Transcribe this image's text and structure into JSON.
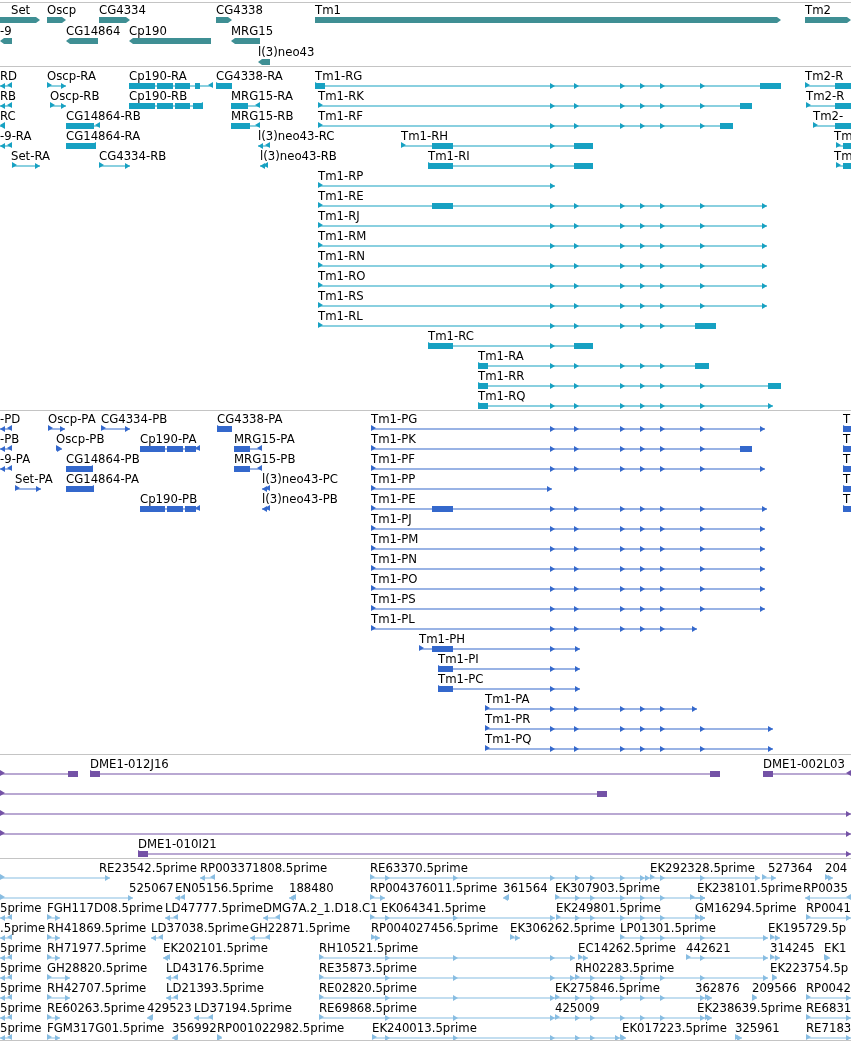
{
  "tracks": [
    {
      "kind": "gene",
      "features": [
        {
          "label": "Set",
          "reverse": false
        },
        {
          "label": "Oscp",
          "reverse": false
        },
        {
          "label": "CG4334",
          "reverse": false
        },
        {
          "label": "CG4338",
          "reverse": false
        },
        {
          "label": "Tm1",
          "reverse": false
        },
        {
          "label": "Tm2",
          "reverse": false
        },
        {
          "label": "-9",
          "reverse": true
        },
        {
          "label": "CG14864",
          "reverse": true
        },
        {
          "label": "Cp190",
          "reverse": true
        },
        {
          "label": "MRG15",
          "reverse": true
        },
        {
          "label": "l(3)neo43",
          "reverse": true
        }
      ]
    },
    {
      "kind": "transcript",
      "features": [
        {
          "label": "RD",
          "reverse": true
        },
        {
          "label": "Oscp-RA",
          "reverse": false
        },
        {
          "label": "Cp190-RA",
          "reverse": true
        },
        {
          "label": "CG4338-RA",
          "reverse": false
        },
        {
          "label": "Tm1-RG",
          "reverse": false
        },
        {
          "label": "Tm2-R",
          "reverse": false
        },
        {
          "label": "RB",
          "reverse": true
        },
        {
          "label": "Oscp-RB",
          "reverse": false
        },
        {
          "label": "Cp190-RB",
          "reverse": true
        },
        {
          "label": "MRG15-RA",
          "reverse": true
        },
        {
          "label": "Tm1-RK",
          "reverse": false
        },
        {
          "label": "Tm2-R",
          "reverse": false
        },
        {
          "label": "RC",
          "reverse": true
        },
        {
          "label": "CG14864-RB",
          "reverse": true
        },
        {
          "label": "MRG15-RB",
          "reverse": true
        },
        {
          "label": "Tm1-RF",
          "reverse": false
        },
        {
          "label": "Tm2-",
          "reverse": false
        },
        {
          "label": "-9-RA",
          "reverse": true
        },
        {
          "label": "CG14864-RA",
          "reverse": true
        },
        {
          "label": "l(3)neo43-RC",
          "reverse": true
        },
        {
          "label": "Tm1-RH",
          "reverse": false
        },
        {
          "label": "Tm",
          "reverse": false
        },
        {
          "label": "Set-RA",
          "reverse": false
        },
        {
          "label": "CG4334-RB",
          "reverse": false
        },
        {
          "label": "l(3)neo43-RB",
          "reverse": true
        },
        {
          "label": "Tm1-RI",
          "reverse": false
        },
        {
          "label": "Tm",
          "reverse": false
        },
        {
          "label": "Tm1-RP",
          "reverse": false
        },
        {
          "label": "Tm1-RE",
          "reverse": false
        },
        {
          "label": "Tm1-RJ",
          "reverse": false
        },
        {
          "label": "Tm1-RM",
          "reverse": false
        },
        {
          "label": "Tm1-RN",
          "reverse": false
        },
        {
          "label": "Tm1-RO",
          "reverse": false
        },
        {
          "label": "Tm1-RS",
          "reverse": false
        },
        {
          "label": "Tm1-RL",
          "reverse": false
        },
        {
          "label": "Tm1-RC",
          "reverse": false
        },
        {
          "label": "Tm1-RA",
          "reverse": false
        },
        {
          "label": "Tm1-RR",
          "reverse": false
        },
        {
          "label": "Tm1-RQ",
          "reverse": false
        }
      ]
    },
    {
      "kind": "cds",
      "features": [
        {
          "label": "-PD",
          "reverse": true
        },
        {
          "label": "Oscp-PA",
          "reverse": false
        },
        {
          "label": "CG4334-PB",
          "reverse": false
        },
        {
          "label": "CG4338-PA",
          "reverse": false
        },
        {
          "label": "Tm1-PG",
          "reverse": false
        },
        {
          "label": "T",
          "reverse": false
        },
        {
          "label": "-PB",
          "reverse": true
        },
        {
          "label": "Oscp-PB",
          "reverse": false
        },
        {
          "label": "Cp190-PA",
          "reverse": true
        },
        {
          "label": "MRG15-PA",
          "reverse": true
        },
        {
          "label": "Tm1-PK",
          "reverse": false
        },
        {
          "label": "T",
          "reverse": false
        },
        {
          "label": "-9-PA",
          "reverse": true
        },
        {
          "label": "CG14864-PB",
          "reverse": true
        },
        {
          "label": "MRG15-PB",
          "reverse": true
        },
        {
          "label": "Tm1-PF",
          "reverse": false
        },
        {
          "label": "T",
          "reverse": false
        },
        {
          "label": "Set-PA",
          "reverse": false
        },
        {
          "label": "CG14864-PA",
          "reverse": true
        },
        {
          "label": "l(3)neo43-PC",
          "reverse": true
        },
        {
          "label": "Tm1-PP",
          "reverse": false
        },
        {
          "label": "T",
          "reverse": false
        },
        {
          "label": "Cp190-PB",
          "reverse": true
        },
        {
          "label": "l(3)neo43-PB",
          "reverse": true
        },
        {
          "label": "Tm1-PE",
          "reverse": false
        },
        {
          "label": "T",
          "reverse": false
        },
        {
          "label": "Tm1-PJ",
          "reverse": false
        },
        {
          "label": "Tm1-PM",
          "reverse": false
        },
        {
          "label": "Tm1-PN",
          "reverse": false
        },
        {
          "label": "Tm1-PO",
          "reverse": false
        },
        {
          "label": "Tm1-PS",
          "reverse": false
        },
        {
          "label": "Tm1-PL",
          "reverse": false
        },
        {
          "label": "Tm1-PH",
          "reverse": false
        },
        {
          "label": "Tm1-PI",
          "reverse": false
        },
        {
          "label": "Tm1-PC",
          "reverse": false
        },
        {
          "label": "Tm1-PA",
          "reverse": false
        },
        {
          "label": "Tm1-PR",
          "reverse": false
        },
        {
          "label": "Tm1-PQ",
          "reverse": false
        }
      ]
    },
    {
      "kind": "clone",
      "features": [
        {
          "reverse": false
        },
        {
          "label": "DME1-012J16",
          "reverse": false
        },
        {
          "label": "DME1-002L03",
          "reverse": true
        },
        {
          "reverse": false
        },
        {
          "reverse": false
        },
        {
          "reverse": false
        },
        {
          "label": "DME1-010I21",
          "reverse": false
        }
      ]
    },
    {
      "kind": "est",
      "features": [
        {
          "label": "RE23542.5prime",
          "reverse": false
        },
        {
          "label": "RP003371808.5prime",
          "reverse": true
        },
        {
          "label": "RE63370.5prime",
          "reverse": false
        },
        {
          "label": "EK292328.5prime",
          "reverse": false
        },
        {
          "label": "527364",
          "reverse": false
        },
        {
          "label": "204",
          "reverse": false
        },
        {
          "label": "525067",
          "reverse": false
        },
        {
          "label": "EN05156.5prime",
          "reverse": true
        },
        {
          "label": "188480",
          "reverse": true
        },
        {
          "label": "RP004376011.5prime",
          "reverse": false
        },
        {
          "label": "361564",
          "reverse": true
        },
        {
          "label": "EK307903.5prime",
          "reverse": false
        },
        {
          "label": "EK238101.5prime",
          "reverse": false
        },
        {
          "label": "RP0035",
          "reverse": true
        },
        {
          "label": "5prime",
          "reverse": true
        },
        {
          "label": "FGH117D08.5prime",
          "reverse": false
        },
        {
          "label": "LD47777.5prime",
          "reverse": true
        },
        {
          "label": "DMG7A.2_1.D18.C1",
          "reverse": true
        },
        {
          "label": "EK064341.5prime",
          "reverse": false
        },
        {
          "label": "EK249801.5prime",
          "reverse": false
        },
        {
          "label": "GM16294.5prime",
          "reverse": false
        },
        {
          "label": "RP0041",
          "reverse": false
        },
        {
          "label": ".5prime",
          "reverse": true
        },
        {
          "label": "RH41869.5prime",
          "reverse": false
        },
        {
          "label": "LD37038.5prime",
          "reverse": true
        },
        {
          "label": "GH22871.5prime",
          "reverse": true
        },
        {
          "label": "RP004027456.5prime",
          "reverse": false
        },
        {
          "label": "EK306262.5prime",
          "reverse": false
        },
        {
          "label": "LP01301.5prime",
          "reverse": false
        },
        {
          "label": "EK195729.5p",
          "reverse": false
        },
        {
          "label": "5prime",
          "reverse": true
        },
        {
          "label": "RH71977.5prime",
          "reverse": false
        },
        {
          "label": "EK202101.5prime",
          "reverse": true
        },
        {
          "label": "RH10521.5prime",
          "reverse": false
        },
        {
          "label": "EC14262.5prime",
          "reverse": false
        },
        {
          "label": "442621",
          "reverse": false
        },
        {
          "label": "314245",
          "reverse": false
        },
        {
          "label": "EK1",
          "reverse": false
        },
        {
          "label": "5prime",
          "reverse": true
        },
        {
          "label": "GH28820.5prime",
          "reverse": false
        },
        {
          "label": "LD43176.5prime",
          "reverse": true
        },
        {
          "label": "RE35873.5prime",
          "reverse": false
        },
        {
          "label": "RH02283.5prime",
          "reverse": false
        },
        {
          "label": "EK223754.5p",
          "reverse": false
        },
        {
          "label": "5prime",
          "reverse": true
        },
        {
          "label": "RH42707.5prime",
          "reverse": false
        },
        {
          "label": "LD21393.5prime",
          "reverse": true
        },
        {
          "label": "RE02820.5prime",
          "reverse": false
        },
        {
          "label": "EK275846.5prime",
          "reverse": false
        },
        {
          "label": "362876",
          "reverse": false
        },
        {
          "label": "209566",
          "reverse": false
        },
        {
          "label": "RP0042",
          "reverse": false
        },
        {
          "label": "5prime",
          "reverse": true
        },
        {
          "label": "RE60263.5prime",
          "reverse": false
        },
        {
          "label": "429523",
          "reverse": true
        },
        {
          "label": "LD37194.5prime",
          "reverse": true
        },
        {
          "label": "RE69868.5prime",
          "reverse": false
        },
        {
          "label": "425009",
          "reverse": false
        },
        {
          "label": "EK238639.5prime",
          "reverse": false
        },
        {
          "label": "RE6831",
          "reverse": false
        },
        {
          "label": "5prime",
          "reverse": true
        },
        {
          "label": "FGM317G01.5prime",
          "reverse": false
        },
        {
          "label": "356992",
          "reverse": true
        },
        {
          "label": "RP001022982.5prime",
          "reverse": false
        },
        {
          "label": "EK240013.5prime",
          "reverse": false
        },
        {
          "label": "EK017223.5prime",
          "reverse": false
        },
        {
          "label": "325961",
          "reverse": false
        },
        {
          "label": "RE7183",
          "reverse": false
        }
      ]
    }
  ]
}
